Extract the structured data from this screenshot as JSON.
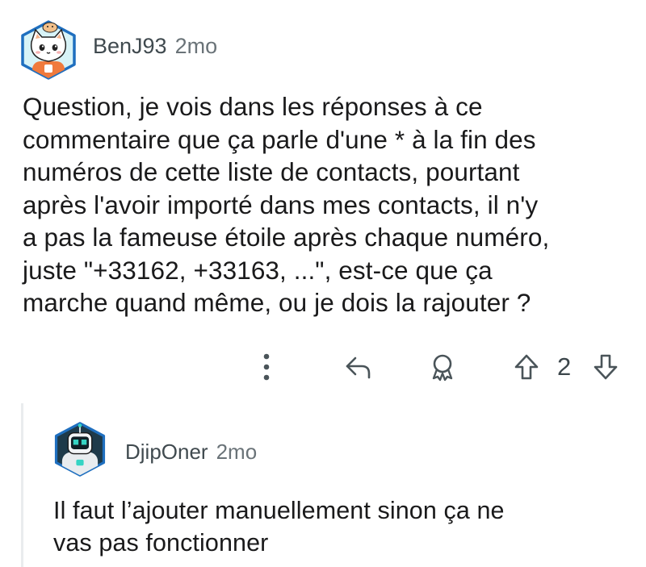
{
  "comment": {
    "username": "BenJ93",
    "time": "2mo",
    "avatar_icon": "cat-avatar-icon",
    "body_lines": [
      "Question, je vois dans les réponses à ce",
      "commentaire que ça parle d'une * à la fin des",
      "numéros de cette liste de contacts, pourtant",
      "après l'avoir importé dans mes contacts, il n'y",
      "a pas la fameuse étoile après chaque numéro,",
      "juste \"+33162, +33163, ...\", est-ce que ça",
      "marche quand même, ou je dois la rajouter ?"
    ],
    "vote_count": "2"
  },
  "reply": {
    "username": "DjipOner",
    "time": "2mo",
    "avatar_icon": "robot-avatar-icon",
    "body_lines": [
      "Il faut l’ajouter manuellement sinon ça ne",
      "vas pas fonctionner"
    ]
  },
  "colors": {
    "avatar_border": "#1f6fbf",
    "cat_bg": "#d7f3f7",
    "robot_bg": "#1e3a4a",
    "icon_color": "#4a5459",
    "thread_line": "#e9ecee"
  }
}
